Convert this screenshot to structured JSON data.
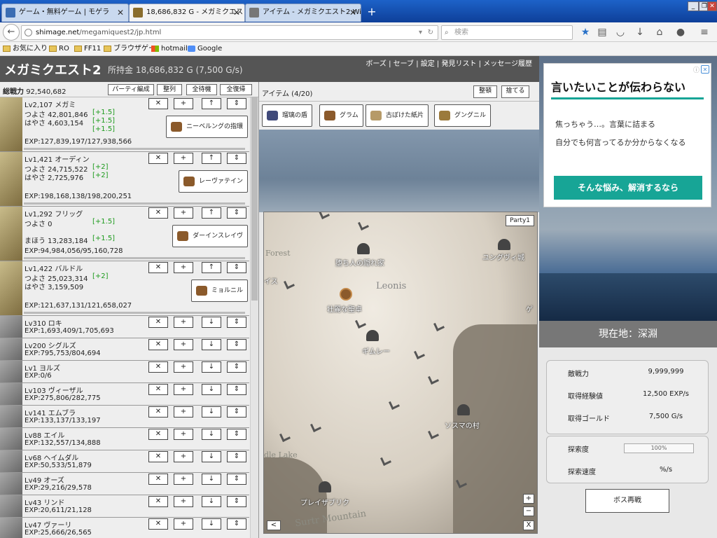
{
  "browser": {
    "tabs": [
      {
        "label": "ゲーム・無料ゲーム | モゲラ",
        "active": false
      },
      {
        "label": "18,686,832 G - メガミクエスト2",
        "active": true
      },
      {
        "label": "アイテム - メガミクエスト2 Wiki*",
        "active": false
      }
    ],
    "url": {
      "domain": "shimage.net",
      "path": "/megamiquest2/jp.html"
    },
    "search_placeholder": "検索",
    "bookmarks": [
      "お気に入り",
      "RO",
      "FF11",
      "ブラウザゲー",
      "hotmail",
      "Google"
    ],
    "accent": "#1d62c8"
  },
  "game": {
    "title": "メガミクエスト2",
    "money": "所持金 18,686,832 G (7,500 G/s)",
    "menu": "ボーズ | セーブ | 設定 | 発見リスト | メッセージ履歴",
    "power_label": "総戦力",
    "power_value": "92,540,682",
    "party_buttons": [
      "パーティ編成",
      "整列",
      "全待機",
      "全復帰"
    ],
    "members": [
      {
        "lv": "Lv2,107",
        "name": "メガミ",
        "lines": [
          "つよさ 42,801,846",
          "はやさ 4,603,154"
        ],
        "bonus": [
          "[+1.5]",
          "[+1.5]",
          "[+1.5]"
        ],
        "exp": "EXP:127,839,197/127,938,566",
        "weapon": "ニーベルングの指環",
        "arrow": "↑",
        "size": "large"
      },
      {
        "lv": "Lv1,421",
        "name": "オーディン",
        "lines": [
          "つよさ 24,715,522",
          "はやさ 2,725,976"
        ],
        "bonus": [
          "[+2]",
          "[+2]"
        ],
        "exp": "EXP:198,168,138/198,200,251",
        "weapon": "レーヴァテイン",
        "arrow": "↑",
        "size": "large"
      },
      {
        "lv": "Lv1,292",
        "name": "フリッグ",
        "lines": [
          "つよさ 0",
          "",
          "まほう 13,283,184"
        ],
        "bonus": [
          "[+1.5]",
          "",
          "[+1.5]"
        ],
        "exp": "EXP:94,984,056/95,160,728",
        "weapon": "ダーインスレイヴ",
        "arrow": "↑",
        "size": "large"
      },
      {
        "lv": "Lv1,422",
        "name": "バルドル",
        "lines": [
          "つよさ 25,023,314",
          "はやさ 3,159,509"
        ],
        "bonus": [
          "[+2]",
          ""
        ],
        "exp": "EXP:121,637,131/121,658,027",
        "weapon": "ミョルニル",
        "arrow": "↑",
        "size": "large"
      },
      {
        "lv": "Lv310",
        "name": "ロキ",
        "exp": "EXP:1,693,409/1,705,693",
        "arrow": "↓",
        "size": "small"
      },
      {
        "lv": "Lv200",
        "name": "シグルズ",
        "exp": "EXP:795,753/804,694",
        "arrow": "↓",
        "size": "small"
      },
      {
        "lv": "Lv1",
        "name": "ヨルズ",
        "exp": "EXP:0/6",
        "arrow": "↓",
        "size": "small"
      },
      {
        "lv": "Lv103",
        "name": "ヴィーザル",
        "exp": "EXP:275,806/282,775",
        "arrow": "↓",
        "size": "small"
      },
      {
        "lv": "Lv141",
        "name": "エムブラ",
        "exp": "EXP:133,137/133,197",
        "arrow": "↓",
        "size": "small"
      },
      {
        "lv": "Lv88",
        "name": "エイル",
        "exp": "EXP:132,557/134,888",
        "arrow": "↓",
        "size": "small"
      },
      {
        "lv": "Lv68",
        "name": "ヘイムダル",
        "exp": "EXP:50,533/51,879",
        "arrow": "↓",
        "size": "small"
      },
      {
        "lv": "Lv49",
        "name": "オーズ",
        "exp": "EXP:29,216/29,578",
        "arrow": "↓",
        "size": "small"
      },
      {
        "lv": "Lv43",
        "name": "リンド",
        "exp": "EXP:20,611/21,128",
        "arrow": "↓",
        "size": "small"
      },
      {
        "lv": "Lv47",
        "name": "ヴァーリ",
        "exp": "EXP:25,666/26,565",
        "arrow": "↓",
        "size": "small"
      }
    ],
    "items_label": "アイテム (4/20)",
    "item_buttons": [
      "整頓",
      "捨てる"
    ],
    "items": [
      "瑠璃の盾",
      "グラム",
      "古ぼけた紙片",
      "グングニル"
    ],
    "map": {
      "party_button": "Party1",
      "labels": [
        {
          "text": "堕ち人の隠れ家"
        },
        {
          "text": "ユングヴィ城"
        },
        {
          "text": "イス"
        },
        {
          "text": "壮麗な聖卓"
        },
        {
          "text": "ギムレー"
        },
        {
          "text": "ソスマの村"
        },
        {
          "text": "プレイザブリク"
        },
        {
          "text": "ゲ"
        }
      ],
      "map_words": [
        "Forest",
        "Leonis",
        "dle Lake",
        "Surtr Mountain"
      ],
      "controls": [
        "+",
        "−",
        "<",
        "X"
      ]
    },
    "location": "現在地：深淵",
    "stats": [
      {
        "label": "敵戦力",
        "value": "9,999,999"
      },
      {
        "label": "取得経験値",
        "value": "12,500 EXP/s"
      },
      {
        "label": "取得ゴールド",
        "value": "7,500 G/s"
      }
    ],
    "explore": {
      "label": "探索度",
      "value": "100%",
      "speed_label": "探索速度",
      "speed_value": "%/s"
    },
    "boss_button": "ボス再戦"
  },
  "ad": {
    "headline": "言いたいことが伝わらない",
    "line1": "焦っちゃう…。言葉に詰まる",
    "line2": "自分でも何言ってるか分からなくなる",
    "button": "そんな悩み、解消するなら",
    "accent": "#17a596"
  }
}
